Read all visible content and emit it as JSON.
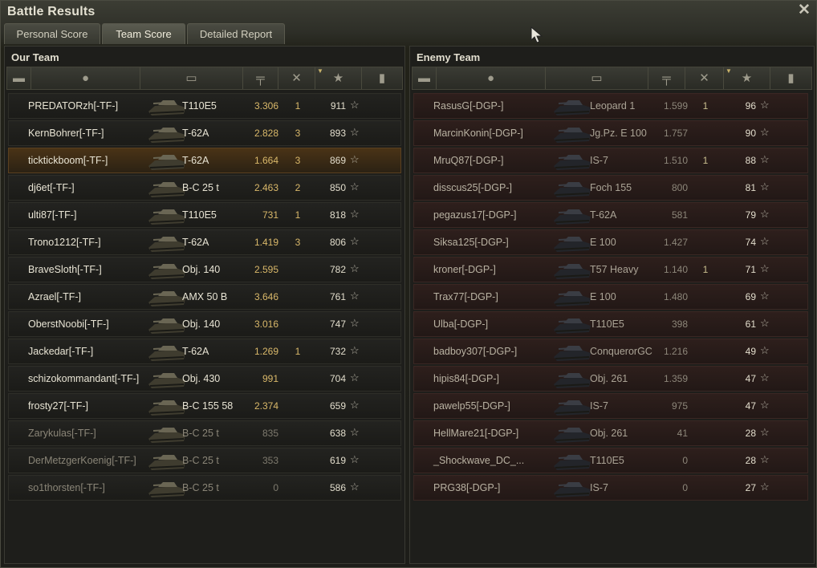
{
  "window": {
    "title": "Battle Results",
    "close_icon": "close-icon"
  },
  "tabs": [
    {
      "label": "Personal Score",
      "active": false
    },
    {
      "label": "Team Score",
      "active": true
    },
    {
      "label": "Detailed Report",
      "active": false
    }
  ],
  "our_team": {
    "title": "Our Team",
    "players": [
      {
        "name": "PREDATORzh[-TF-]",
        "vehicle": "T110E5",
        "damage": "3.306",
        "kills": "1",
        "xp": "911",
        "state": "alive"
      },
      {
        "name": "KernBohrer[-TF-]",
        "vehicle": "T-62A",
        "damage": "2.828",
        "kills": "3",
        "xp": "893",
        "state": "alive"
      },
      {
        "name": "ticktickboom[-TF-]",
        "vehicle": "T-62A",
        "damage": "1.664",
        "kills": "3",
        "xp": "869",
        "state": "self"
      },
      {
        "name": "dj6et[-TF-]",
        "vehicle": "B-C 25 t",
        "damage": "2.463",
        "kills": "2",
        "xp": "850",
        "state": "alive"
      },
      {
        "name": "ulti87[-TF-]",
        "vehicle": "T110E5",
        "damage": "731",
        "kills": "1",
        "xp": "818",
        "state": "alive"
      },
      {
        "name": "Trono1212[-TF-]",
        "vehicle": "T-62A",
        "damage": "1.419",
        "kills": "3",
        "xp": "806",
        "state": "alive"
      },
      {
        "name": "BraveSloth[-TF-]",
        "vehicle": "Obj. 140",
        "damage": "2.595",
        "kills": "",
        "xp": "782",
        "state": "alive"
      },
      {
        "name": "Azrael[-TF-]",
        "vehicle": "AMX 50 B",
        "damage": "3.646",
        "kills": "",
        "xp": "761",
        "state": "alive"
      },
      {
        "name": "OberstNoobi[-TF-]",
        "vehicle": "Obj. 140",
        "damage": "3.016",
        "kills": "",
        "xp": "747",
        "state": "alive"
      },
      {
        "name": "Jackedar[-TF-]",
        "vehicle": "T-62A",
        "damage": "1.269",
        "kills": "1",
        "xp": "732",
        "state": "alive"
      },
      {
        "name": "schizokommandant[-TF-]",
        "vehicle": "Obj. 430",
        "damage": "991",
        "kills": "",
        "xp": "704",
        "state": "alive"
      },
      {
        "name": "frosty27[-TF-]",
        "vehicle": "B-C 155 58",
        "damage": "2.374",
        "kills": "",
        "xp": "659",
        "state": "alive"
      },
      {
        "name": "Zarykulas[-TF-]",
        "vehicle": "B-C 25 t",
        "damage": "835",
        "kills": "",
        "xp": "638",
        "state": "dead"
      },
      {
        "name": "DerMetzgerKoenig[-TF-]",
        "vehicle": "B-C 25 t",
        "damage": "353",
        "kills": "",
        "xp": "619",
        "state": "dead"
      },
      {
        "name": "so1thorsten[-TF-]",
        "vehicle": "B-C 25 t",
        "damage": "0",
        "kills": "",
        "xp": "586",
        "state": "dead"
      }
    ]
  },
  "enemy_team": {
    "title": "Enemy Team",
    "players": [
      {
        "name": "RasusG[-DGP-]",
        "vehicle": "Leopard 1",
        "damage": "1.599",
        "kills": "1",
        "xp": "96"
      },
      {
        "name": "MarcinKonin[-DGP-]",
        "vehicle": "Jg.Pz. E 100",
        "damage": "1.757",
        "kills": "",
        "xp": "90"
      },
      {
        "name": "MruQ87[-DGP-]",
        "vehicle": "IS-7",
        "damage": "1.510",
        "kills": "1",
        "xp": "88"
      },
      {
        "name": "disscus25[-DGP-]",
        "vehicle": "Foch 155",
        "damage": "800",
        "kills": "",
        "xp": "81"
      },
      {
        "name": "pegazus17[-DGP-]",
        "vehicle": "T-62A",
        "damage": "581",
        "kills": "",
        "xp": "79"
      },
      {
        "name": "Siksa125[-DGP-]",
        "vehicle": "E 100",
        "damage": "1.427",
        "kills": "",
        "xp": "74"
      },
      {
        "name": "kroner[-DGP-]",
        "vehicle": "T57 Heavy",
        "damage": "1.140",
        "kills": "1",
        "xp": "71"
      },
      {
        "name": "Trax77[-DGP-]",
        "vehicle": "E 100",
        "damage": "1.480",
        "kills": "",
        "xp": "69"
      },
      {
        "name": "Ulba[-DGP-]",
        "vehicle": "T110E5",
        "damage": "398",
        "kills": "",
        "xp": "61"
      },
      {
        "name": "badboy307[-DGP-]",
        "vehicle": "ConquerorGC",
        "damage": "1.216",
        "kills": "",
        "xp": "49"
      },
      {
        "name": "hipis84[-DGP-]",
        "vehicle": "Obj. 261",
        "damage": "1.359",
        "kills": "",
        "xp": "47"
      },
      {
        "name": "pawelp55[-DGP-]",
        "vehicle": "IS-7",
        "damage": "975",
        "kills": "",
        "xp": "47"
      },
      {
        "name": "HellMare21[-DGP-]",
        "vehicle": "Obj. 261",
        "damage": "41",
        "kills": "",
        "xp": "28"
      },
      {
        "name": "_Shockwave_DC_...",
        "vehicle": "T110E5",
        "damage": "0",
        "kills": "",
        "xp": "28"
      },
      {
        "name": "PRG38[-DGP-]",
        "vehicle": "IS-7",
        "damage": "0",
        "kills": "",
        "xp": "27"
      }
    ]
  },
  "columns": {
    "squad_icon": "squad-icon",
    "player_icon": "player-icon",
    "tank_icon": "tank-icon",
    "damage_icon": "damage-icon",
    "kills_icon": "kills-icon",
    "xp_icon": "star-icon",
    "medal_icon": "medal-icon",
    "sorted_column": "xp"
  },
  "colors": {
    "accent": "#d9b86a",
    "self_row": "#4a3316",
    "enemy_row": "#2e1f1c"
  },
  "star_glyph": "☆"
}
